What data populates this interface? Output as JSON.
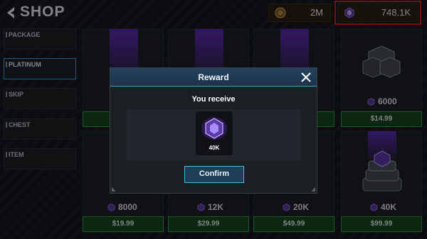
{
  "header": {
    "title": "SHOP",
    "gold_amount": "2M",
    "platinum_amount": "748.1K"
  },
  "sidebar": {
    "tabs": [
      {
        "label": "PACKAGE",
        "active": false
      },
      {
        "label": "PLATINUM",
        "active": true
      },
      {
        "label": "SKIP",
        "active": false
      },
      {
        "label": "CHEST",
        "active": false
      },
      {
        "label": "ITEM",
        "active": false
      }
    ]
  },
  "products": [
    {
      "amount": "",
      "price": ""
    },
    {
      "amount": "",
      "price": ""
    },
    {
      "amount": "",
      "price": ""
    },
    {
      "amount": "6000",
      "price": "$14.99"
    },
    {
      "amount": "8000",
      "price": "$19.99"
    },
    {
      "amount": "12K",
      "price": "$29.99"
    },
    {
      "amount": "20K",
      "price": "$49.99"
    },
    {
      "amount": "40K",
      "price": "$99.99"
    }
  ],
  "modal": {
    "title": "Reward",
    "subtitle": "You receive",
    "reward_amount": "40K",
    "confirm_label": "Confirm"
  },
  "colors": {
    "platinum_highlight": "#e0191b",
    "accent_blue": "#3aa3d8",
    "price_green": "#2f9b44",
    "gem_purple": "#7a4ee0"
  },
  "icons": {
    "back": "chevron-left-icon",
    "gold": "gold-coin-icon",
    "platinum": "platinum-gem-icon",
    "close": "close-icon"
  }
}
